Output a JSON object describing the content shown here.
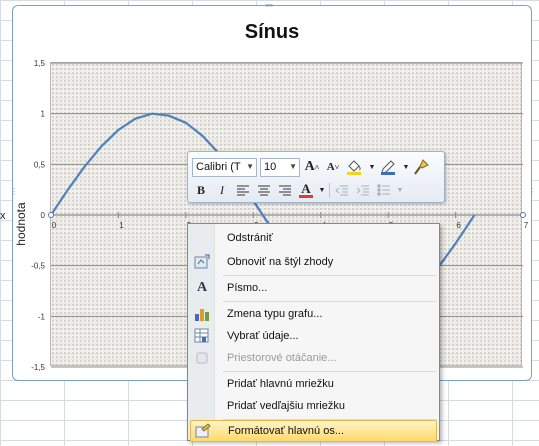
{
  "sheet": {
    "stub_label": "x"
  },
  "chart_data": {
    "type": "line",
    "title": "Sínus",
    "ylabel": "hodnota",
    "xlabel": "",
    "xlim": [
      0,
      7
    ],
    "ylim": [
      -1.5,
      1.5
    ],
    "x_ticks": [
      "0",
      "1",
      "2",
      "3",
      "4",
      "5",
      "6",
      "7"
    ],
    "y_ticks": [
      "1,5",
      "1",
      "0,5",
      "0",
      "-0,5",
      "-1",
      "-1,5"
    ],
    "grid": true,
    "legend": "none",
    "series": [
      {
        "x": [
          0,
          0.25,
          0.5,
          0.75,
          1,
          1.25,
          1.5,
          1.75,
          2,
          2.25,
          2.5,
          2.75,
          3,
          3.25,
          3.5,
          3.75,
          4,
          4.25,
          4.5,
          4.75,
          5,
          5.25,
          5.5,
          5.75,
          6,
          6.28
        ],
        "y": [
          0,
          0.25,
          0.48,
          0.68,
          0.84,
          0.95,
          1.0,
          0.98,
          0.91,
          0.78,
          0.6,
          0.38,
          0.14,
          -0.11,
          -0.35,
          -0.57,
          -0.76,
          -0.89,
          -0.98,
          -1.0,
          -0.96,
          -0.86,
          -0.71,
          -0.51,
          -0.28,
          0
        ]
      }
    ],
    "colors": {
      "line": "#4f81bd",
      "gridline": "#8c8c8c",
      "axis": "#8c8c8c",
      "plot_bg": "#ebe8e3"
    }
  },
  "mini_toolbar": {
    "font_name": "Calibri (T",
    "font_size": "10",
    "grow_font": "A",
    "shrink_font": "A",
    "bold": "B",
    "italic": "I",
    "font_color_glyph": "A",
    "colors": {
      "font_color": "#e23b2d",
      "fill_color": "#f2d41f",
      "outline_color": "#3c6fbe"
    },
    "icons": [
      "grow-font-icon",
      "shrink-font-icon",
      "fill-color-icon",
      "outline-color-icon",
      "format-painter-icon",
      "align-left-icon",
      "align-center-icon",
      "align-right-icon",
      "font-color-icon",
      "decrease-indent-icon",
      "increase-indent-icon",
      "bullets-icon"
    ]
  },
  "context_menu": {
    "items": [
      {
        "label": "Odstrániť",
        "icon": "none",
        "enabled": true
      },
      {
        "label": "Obnoviť na štýl zhody",
        "icon": "reset-style-icon",
        "enabled": true
      },
      {
        "label": "Písmo...",
        "icon": "font-icon",
        "enabled": true
      },
      {
        "label": "Zmena typu grafu...",
        "icon": "chart-type-icon",
        "enabled": true
      },
      {
        "label": "Vybrať údaje...",
        "icon": "select-data-icon",
        "enabled": true
      },
      {
        "label": "Priestorové otáčanie...",
        "icon": "3d-rotation-icon",
        "enabled": false
      },
      {
        "label": "Pridať hlavnú mriežku",
        "icon": "none",
        "enabled": true
      },
      {
        "label": "Pridať vedľajšiu mriežku",
        "icon": "none",
        "enabled": true
      },
      {
        "label": "Formátovať hlavnú os...",
        "icon": "format-axis-icon",
        "enabled": true,
        "highlighted": true
      }
    ]
  }
}
